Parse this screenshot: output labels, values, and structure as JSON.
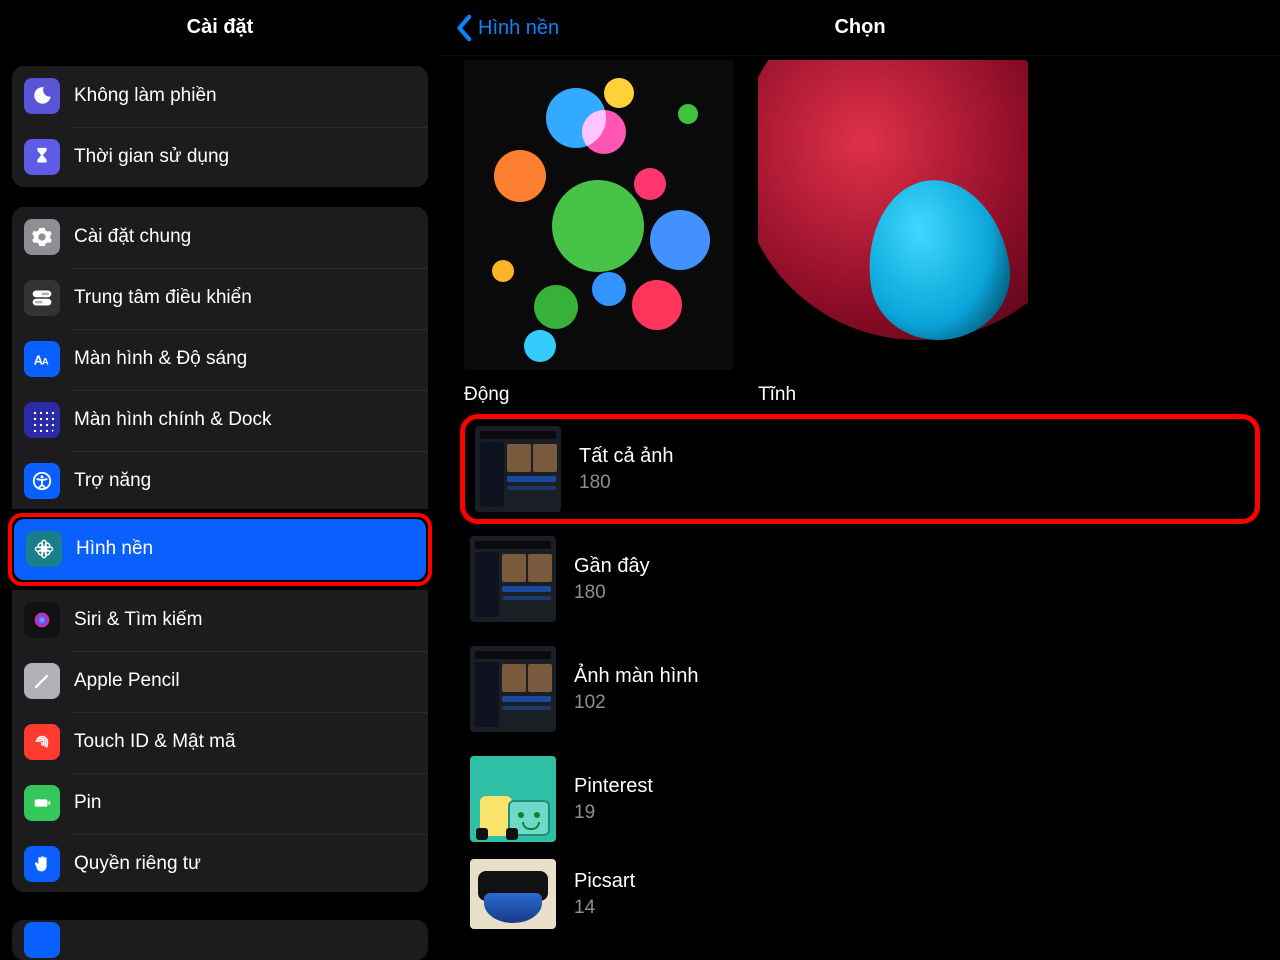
{
  "sidebar": {
    "title": "Cài đặt",
    "group1": [
      {
        "id": "dnd",
        "label": "Không làm phiền"
      },
      {
        "id": "screen",
        "label": "Thời gian sử dụng"
      }
    ],
    "group2": [
      {
        "id": "general",
        "label": "Cài đặt chung"
      },
      {
        "id": "controlcenter",
        "label": "Trung tâm điều khiển"
      },
      {
        "id": "display",
        "label": "Màn hình & Độ sáng"
      },
      {
        "id": "homedock",
        "label": "Màn hình chính & Dock"
      },
      {
        "id": "accessibility",
        "label": "Trợ năng"
      },
      {
        "id": "wallpaper",
        "label": "Hình nền"
      },
      {
        "id": "siri",
        "label": "Siri & Tìm kiếm"
      },
      {
        "id": "pencil",
        "label": "Apple Pencil"
      },
      {
        "id": "touchid",
        "label": "Touch ID & Mật mã"
      },
      {
        "id": "battery",
        "label": "Pin"
      },
      {
        "id": "privacy",
        "label": "Quyền riêng tư"
      }
    ]
  },
  "detail": {
    "back_label": "Hình nền",
    "title": "Chọn",
    "wallpaper_categories": [
      {
        "id": "dynamic",
        "label": "Động"
      },
      {
        "id": "still",
        "label": "Tĩnh"
      }
    ],
    "albums": [
      {
        "id": "all",
        "title": "Tất cả ảnh",
        "count": "180",
        "highlight": true
      },
      {
        "id": "recent",
        "title": "Gần đây",
        "count": "180",
        "highlight": false
      },
      {
        "id": "screenshots",
        "title": "Ảnh màn hình",
        "count": "102",
        "highlight": false
      },
      {
        "id": "pinterest",
        "title": "Pinterest",
        "count": "19",
        "highlight": false
      },
      {
        "id": "picsart",
        "title": "Picsart",
        "count": "14",
        "highlight": false
      }
    ]
  }
}
